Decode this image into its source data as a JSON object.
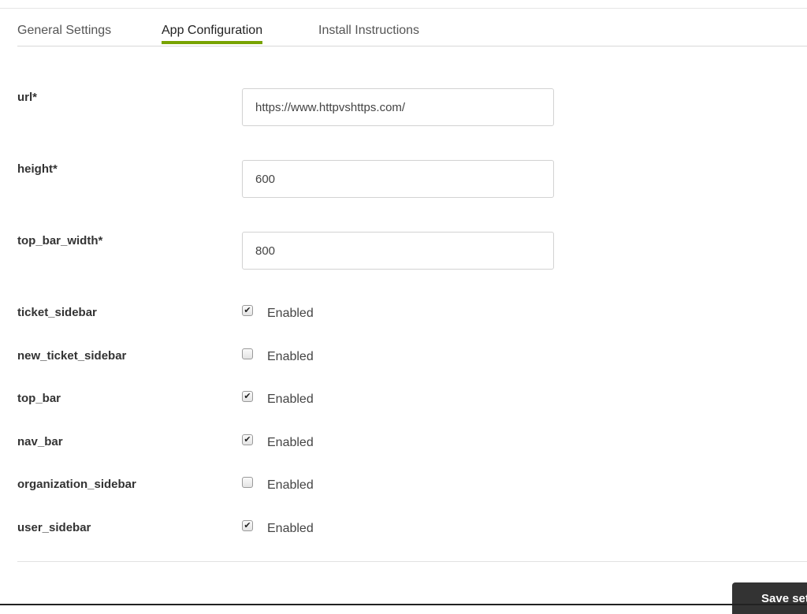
{
  "tabs": [
    {
      "label": "General Settings",
      "active": false
    },
    {
      "label": "App Configuration",
      "active": true
    },
    {
      "label": "Install Instructions",
      "active": false
    }
  ],
  "fields": {
    "url": {
      "label": "url*",
      "value": "https://www.httpvshttps.com/"
    },
    "height": {
      "label": "height*",
      "value": "600"
    },
    "top_bar_width": {
      "label": "top_bar_width*",
      "value": "800"
    }
  },
  "toggles": [
    {
      "label": "ticket_sidebar",
      "checked": true,
      "text": "Enabled"
    },
    {
      "label": "new_ticket_sidebar",
      "checked": false,
      "text": "Enabled"
    },
    {
      "label": "top_bar",
      "checked": true,
      "text": "Enabled"
    },
    {
      "label": "nav_bar",
      "checked": true,
      "text": "Enabled"
    },
    {
      "label": "organization_sidebar",
      "checked": false,
      "text": "Enabled"
    },
    {
      "label": "user_sidebar",
      "checked": true,
      "text": "Enabled"
    }
  ],
  "save_button": {
    "label": "Save settings"
  },
  "colors": {
    "accent": "#78a300",
    "button": "#333333"
  }
}
